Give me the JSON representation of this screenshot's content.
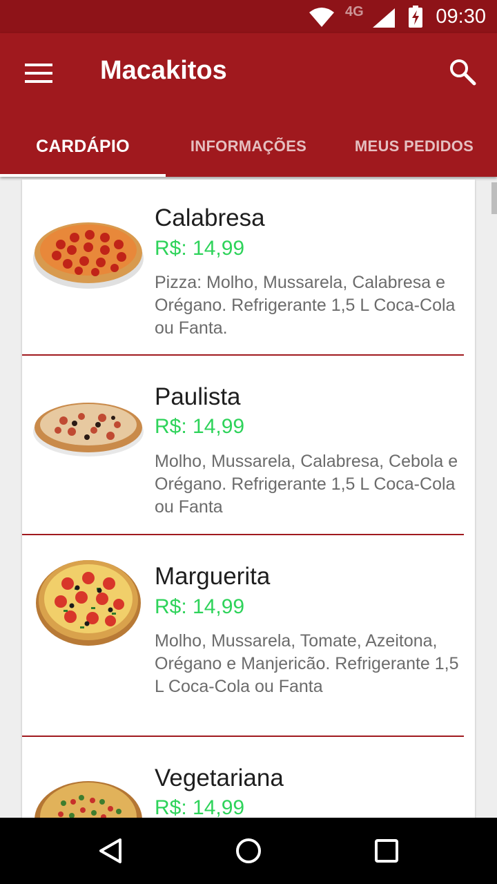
{
  "status_bar": {
    "network": "4G",
    "time": "09:30",
    "icons": [
      "wifi-icon",
      "signal-icon",
      "battery-charging-icon"
    ]
  },
  "app_bar": {
    "title": "Macakitos",
    "menu_icon": "hamburger-menu-icon",
    "search_icon": "search-icon",
    "color": "#a0191e"
  },
  "tabs": [
    {
      "label": "CARDÁPIO",
      "active": true
    },
    {
      "label": "INFORMAÇÕES",
      "active": false
    },
    {
      "label": "MEUS PEDIDOS",
      "active": false
    }
  ],
  "menu_items": [
    {
      "name": "Calabresa",
      "price": "R$: 14,99",
      "description": "Pizza: Molho, Mussarela, Calabresa e Orégano. Refrigerante 1,5 L Coca-Cola ou Fanta."
    },
    {
      "name": "Paulista",
      "price": "R$: 14,99",
      "description": "Molho, Mussarela, Calabresa, Cebola e Orégano. Refrigerante 1,5 L Coca-Cola ou Fanta"
    },
    {
      "name": "Marguerita",
      "price": "R$: 14,99",
      "description": "Molho, Mussarela, Tomate, Azeitona, Orégano e Manjericão. Refrigerante 1,5 L Coca-Cola ou Fanta"
    },
    {
      "name": "Vegetariana",
      "price": "R$: 14,99",
      "description": ""
    }
  ],
  "colors": {
    "accent": "#a0191e",
    "status_bar": "#8e1318",
    "price": "#2ed35a"
  },
  "nav_bar": {
    "icons": [
      "back-icon",
      "home-icon",
      "recents-icon"
    ]
  }
}
